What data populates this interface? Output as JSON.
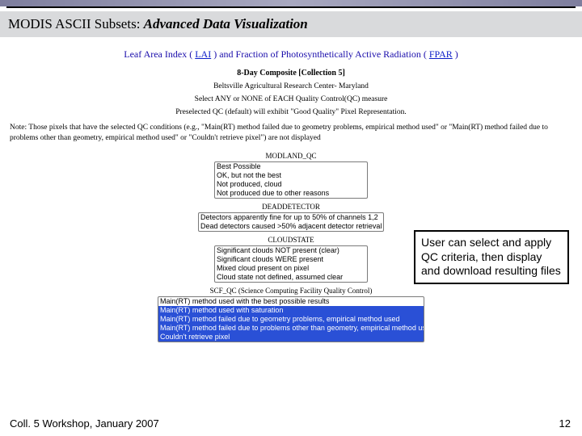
{
  "header": {
    "title_prefix": "MODIS ASCII Subsets: ",
    "title_italic": "Advanced Data Visualization"
  },
  "subtitle": {
    "pre": "Leaf Area Index ( ",
    "link1": "LAI",
    "mid": " ) and Fraction of Photosynthetically Active Radiation ( ",
    "link2": "FPAR",
    "post": " )"
  },
  "labels": {
    "composite": "8-Day Composite [Collection 5]",
    "site": "Beltsville Agricultural Research Center- Maryland",
    "instruction": "Select ANY or NONE of EACH Quality Control(QC) measure",
    "default_note": "Preselected QC (default) will exhibit \"Good Quality\" Pixel Representation."
  },
  "note": "Note: Those pixels that have the selected QC conditions (e.g., \"Main(RT) method failed due to geometry problems, empirical method used\" or \"Main(RT) method failed due to problems other than geometry, empirical method used\" or \"Couldn't retrieve pixel\") are not displayed",
  "qc": {
    "modland": {
      "heading": "MODLAND_QC",
      "options": [
        "Best Possible",
        "OK, but not the best",
        "Not produced, cloud",
        "Not produced due to other reasons"
      ]
    },
    "detector": {
      "heading": "DEADDETECTOR",
      "options": [
        "Detectors apparently fine for up to 50% of channels 1,2",
        "Dead detectors caused >50% adjacent detector retrieval"
      ]
    },
    "cloud": {
      "heading": "CLOUDSTATE",
      "options": [
        "Significant clouds NOT present (clear)",
        "Significant clouds WERE present",
        "Mixed cloud present on pixel",
        "Cloud state not defined, assumed clear"
      ]
    },
    "scf": {
      "heading": "SCF_QC (Science Computing Facility Quality Control)",
      "options": [
        "Main(RT) method used with the best possible results",
        "Main(RT) method used with saturation",
        "Main(RT) method failed due to geometry problems, empirical method used",
        "Main(RT) method failed due to problems other than geometry, empirical method used",
        "Couldn't retrieve pixel"
      ]
    }
  },
  "callout": "User can select and apply QC criteria, then display and download resulting files",
  "footer": {
    "left": "Coll. 5 Workshop, January 2007",
    "right": "12"
  }
}
